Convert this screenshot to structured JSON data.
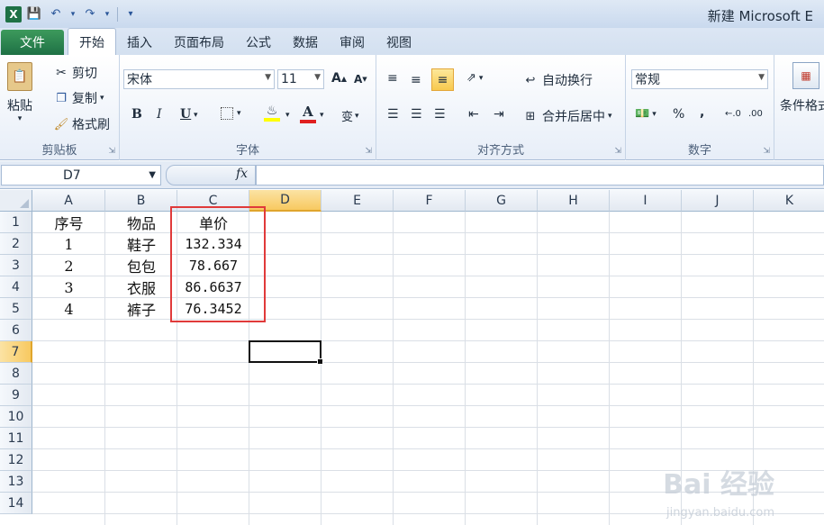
{
  "window": {
    "title": "新建 Microsoft E"
  },
  "qat": {
    "app_icon": "X"
  },
  "tabs": [
    "文件",
    "开始",
    "插入",
    "页面布局",
    "公式",
    "数据",
    "审阅",
    "视图"
  ],
  "active_tab": "开始",
  "clipboard": {
    "paste": "粘贴",
    "cut": "剪切",
    "copy": "复制",
    "format_painter": "格式刷",
    "label": "剪贴板"
  },
  "font": {
    "family": "宋体",
    "size": "11",
    "label": "字体",
    "bold": "B",
    "italic": "I",
    "underline": "U",
    "wen": "变"
  },
  "alignment": {
    "wrap": "自动换行",
    "merge": "合并后居中",
    "label": "对齐方式"
  },
  "number": {
    "format": "常规",
    "percent": "%",
    "comma": ",",
    "label": "数字"
  },
  "styles": {
    "conditional": "条件格式"
  },
  "formula_bar": {
    "name_box": "D7",
    "fx": "fx",
    "formula": ""
  },
  "columns": [
    "A",
    "B",
    "C",
    "D",
    "E",
    "F",
    "G",
    "H",
    "I",
    "J",
    "K"
  ],
  "rows": [
    "1",
    "2",
    "3",
    "4",
    "5",
    "6",
    "7",
    "8",
    "9",
    "10",
    "11",
    "12",
    "13",
    "14"
  ],
  "selected": {
    "column": "D",
    "row": "7"
  },
  "sheet": {
    "headers": [
      "序号",
      "物品",
      "单价"
    ],
    "data": [
      [
        "1",
        "鞋子",
        "132.334"
      ],
      [
        "2",
        "包包",
        "78.667"
      ],
      [
        "3",
        "衣服",
        "86.6637"
      ],
      [
        "4",
        "裤子",
        "76.3452"
      ]
    ]
  },
  "watermark": {
    "main": "Bai 经验",
    "sub": "jingyan.baidu.com"
  },
  "colors": {
    "excel_green": "#1e7145",
    "selection_header": "#f8c960",
    "highlight_box": "#e03a3a"
  }
}
